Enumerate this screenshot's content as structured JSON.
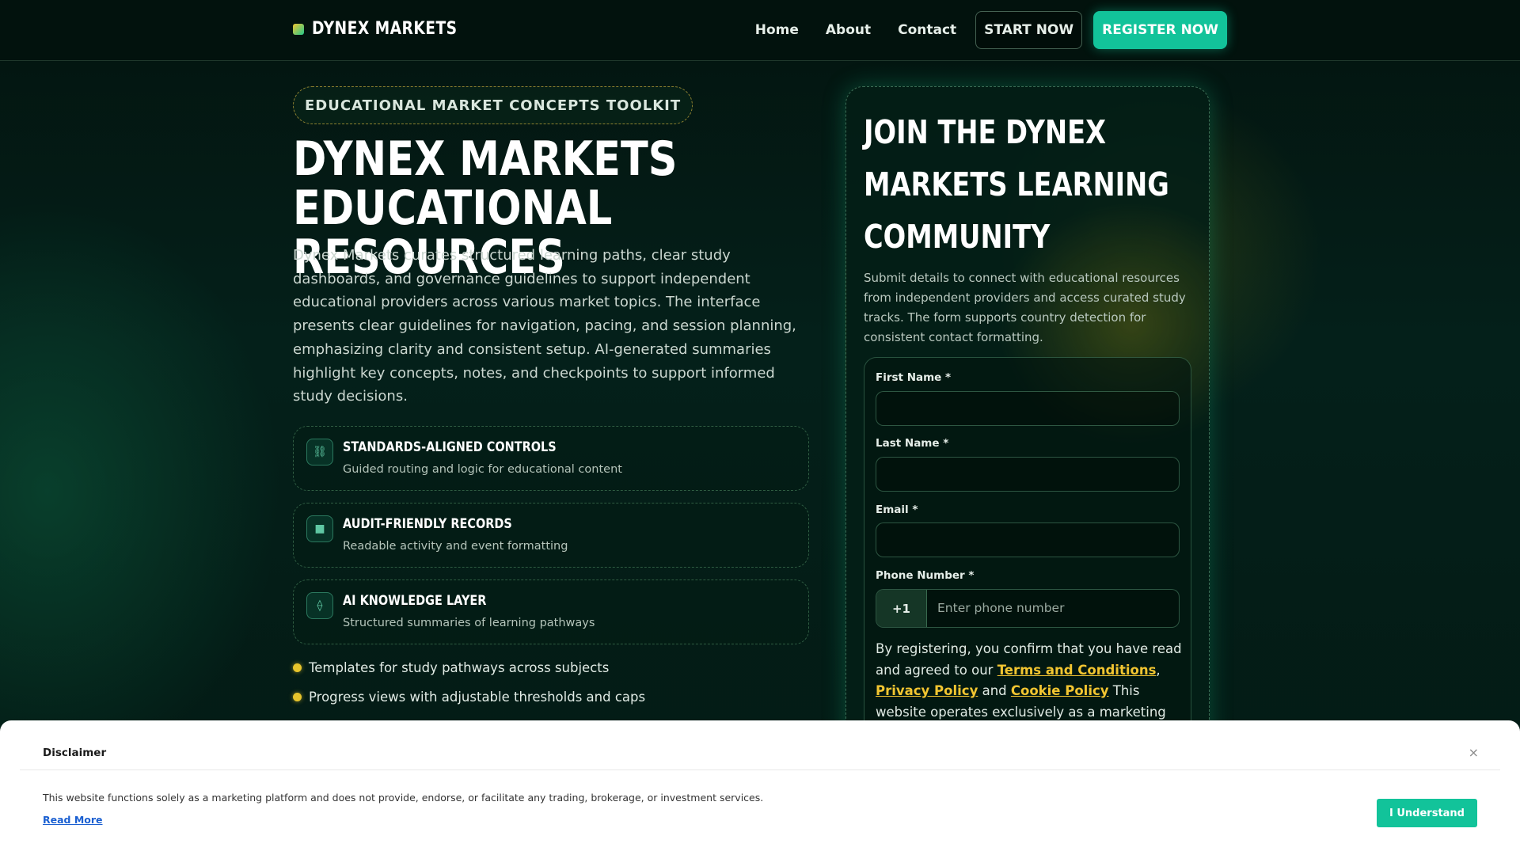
{
  "brand": {
    "name": "DYNEX MARKETS"
  },
  "nav": {
    "links": [
      "Home",
      "About",
      "Contact"
    ],
    "start_label": "START NOW",
    "register_label": "REGISTER NOW"
  },
  "hero": {
    "badge": "EDUCATIONAL MARKET CONCEPTS TOOLKIT",
    "title_line1": "DYNEX MARKETS",
    "title_line2": "EDUCATIONAL RESOURCES",
    "description": "Dynex Markets curates structured learning paths, clear study dashboards, and governance guidelines to support independent educational providers across various market topics. The interface presents clear guidelines for navigation, pacing, and session planning, emphasizing clarity and consistent setup. AI-generated summaries highlight key concepts, notes, and checkpoints to support informed study decisions."
  },
  "features": [
    {
      "icon": "link-icon",
      "glyph": "⛓",
      "title": "STANDARDS-ALIGNED CONTROLS",
      "desc": "Guided routing and logic for educational content"
    },
    {
      "icon": "square-icon",
      "glyph": "■",
      "title": "AUDIT-FRIENDLY RECORDS",
      "desc": "Readable activity and event formatting"
    },
    {
      "icon": "ethereum-icon",
      "glyph": "⟠",
      "title": "AI KNOWLEDGE LAYER",
      "desc": "Structured summaries of learning pathways"
    }
  ],
  "bullets": [
    "Templates for study pathways across subjects",
    "Progress views with adjustable thresholds and caps"
  ],
  "signup": {
    "title_line1": "JOIN THE DYNEX",
    "title_line2": "MARKETS LEARNING",
    "title_line3": "COMMUNITY",
    "description": "Submit details to connect with educational resources from independent providers and access curated study tracks. The form supports country detection for consistent contact formatting.",
    "first_name_label": "First Name *",
    "last_name_label": "Last Name *",
    "email_label": "Email *",
    "phone_label": "Phone Number *",
    "phone_code": "+1",
    "phone_placeholder": "Enter phone number",
    "consent_prefix": "By registering, you confirm that you have read and agreed to our ",
    "terms_label": "Terms and Conditions",
    "comma": ", ",
    "privacy_label": "Privacy Policy",
    "and": " and ",
    "cookie_label": "Cookie Policy",
    "consent_suffix": " This website operates exclusively as a marketing"
  },
  "disclaimer": {
    "title": "Disclaimer",
    "close": "×",
    "text": "This website functions solely as a marketing platform and does not provide, endorse, or facilitate any trading, brokerage, or investment services.",
    "read_more": "Read More",
    "button": "I Understand"
  },
  "colors": {
    "accent": "#12c39a",
    "gold": "#f2c531",
    "background": "#04201a"
  }
}
